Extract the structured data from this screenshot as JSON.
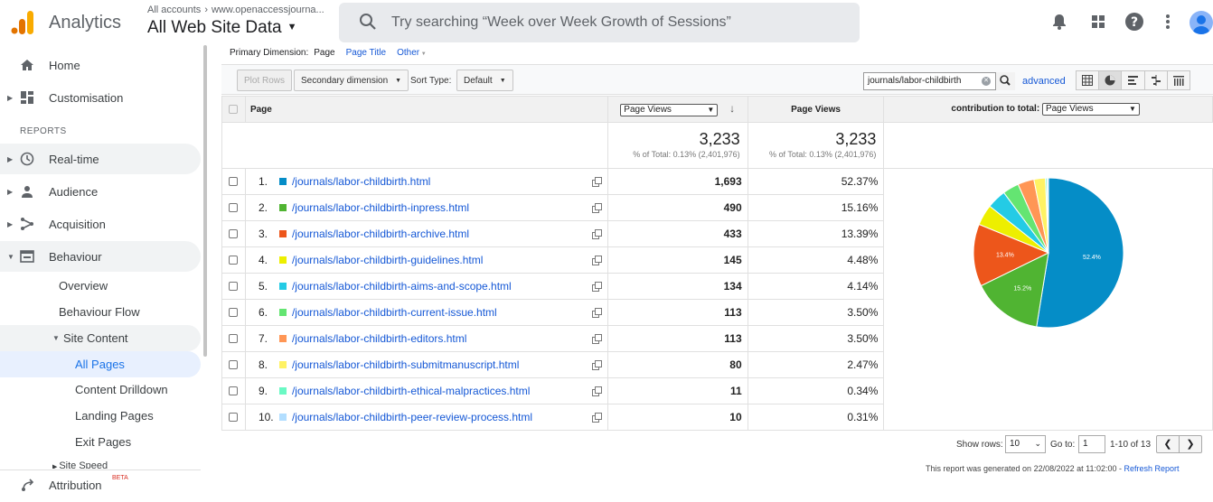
{
  "topbar": {
    "product": "Analytics",
    "account_path": [
      "All accounts",
      "www.openaccessjourna..."
    ],
    "view": "All Web Site Data",
    "search_placeholder": "Try searching “Week over Week Growth of Sessions”",
    "icons": [
      "bell-icon",
      "apps-grid-icon",
      "help-icon",
      "more-vert-icon",
      "avatar-icon"
    ]
  },
  "sidebar": {
    "home": "Home",
    "customisation": "Customisation",
    "reports_header": "REPORTS",
    "realtime": "Real-time",
    "audience": "Audience",
    "acquisition": "Acquisition",
    "behaviour": "Behaviour",
    "overview": "Overview",
    "behaviour_flow": "Behaviour Flow",
    "site_content": "Site Content",
    "all_pages": "All Pages",
    "content_drilldown": "Content Drilldown",
    "landing_pages": "Landing Pages",
    "exit_pages": "Exit Pages",
    "site_speed": "Site Speed",
    "attribution": "Attribution",
    "beta": "BETA"
  },
  "report": {
    "primary_dimension_label": "Primary Dimension:",
    "dim_page": "Page",
    "dim_page_title": "Page Title",
    "dim_other": "Other",
    "plot_rows": "Plot Rows",
    "secondary_dimension": "Secondary dimension",
    "sort_type_label": "Sort Type:",
    "sort_type": "Default",
    "filter_value": "journals/labor-childbirth",
    "advanced": "advanced",
    "col_page": "Page",
    "col_metric_select": "Page Views",
    "col_page_views": "Page Views",
    "col_contribution": "contribution to total:",
    "col_contribution_select": "Page Views",
    "total_value": "3,233",
    "total_pct": "% of Total: 0.13% (2,401,976)",
    "total_value2": "3,233",
    "total_pct2": "% of Total: 0.13% (2,401,976)",
    "rows": [
      {
        "n": "1.",
        "page": "/journals/labor-childbirth.html",
        "views": "1,693",
        "pct": "52.37%",
        "color": "#058dc7"
      },
      {
        "n": "2.",
        "page": "/journals/labor-childbirth-inpress.html",
        "views": "490",
        "pct": "15.16%",
        "color": "#50b432"
      },
      {
        "n": "3.",
        "page": "/journals/labor-childbirth-archive.html",
        "views": "433",
        "pct": "13.39%",
        "color": "#ed561b"
      },
      {
        "n": "4.",
        "page": "/journals/labor-childbirth-guidelines.html",
        "views": "145",
        "pct": "4.48%",
        "color": "#edef00"
      },
      {
        "n": "5.",
        "page": "/journals/labor-childbirth-aims-and-scope.html",
        "views": "134",
        "pct": "4.14%",
        "color": "#24cbe5"
      },
      {
        "n": "6.",
        "page": "/journals/labor-childbirth-current-issue.html",
        "views": "113",
        "pct": "3.50%",
        "color": "#64e572"
      },
      {
        "n": "7.",
        "page": "/journals/labor-childbirth-editors.html",
        "views": "113",
        "pct": "3.50%",
        "color": "#ff9655"
      },
      {
        "n": "8.",
        "page": "/journals/labor-childbirth-submitmanuscript.html",
        "views": "80",
        "pct": "2.47%",
        "color": "#fff263"
      },
      {
        "n": "9.",
        "page": "/journals/labor-childbirth-ethical-malpractices.html",
        "views": "11",
        "pct": "0.34%",
        "color": "#6af9c4"
      },
      {
        "n": "10.",
        "page": "/journals/labor-childbirth-peer-review-process.html",
        "views": "10",
        "pct": "0.31%",
        "color": "#b2deff"
      }
    ],
    "show_rows_label": "Show rows:",
    "show_rows": "10",
    "goto_label": "Go to:",
    "goto": "1",
    "range": "1-10 of 13",
    "generated": "This report was generated on 22/08/2022 at 11:02:00 -",
    "refresh": "Refresh Report"
  },
  "chart_data": {
    "type": "pie",
    "values": [
      52.37,
      15.16,
      13.39,
      4.48,
      4.14,
      3.5,
      3.5,
      2.47,
      0.34,
      0.31
    ],
    "colors": [
      "#058dc7",
      "#50b432",
      "#ed561b",
      "#edef00",
      "#24cbe5",
      "#64e572",
      "#ff9655",
      "#fff263",
      "#6af9c4",
      "#b2deff"
    ],
    "labels": [
      "52.4%",
      "15.2%",
      "13.4%",
      "",
      "",
      "",
      "",
      "",
      "",
      ""
    ]
  }
}
